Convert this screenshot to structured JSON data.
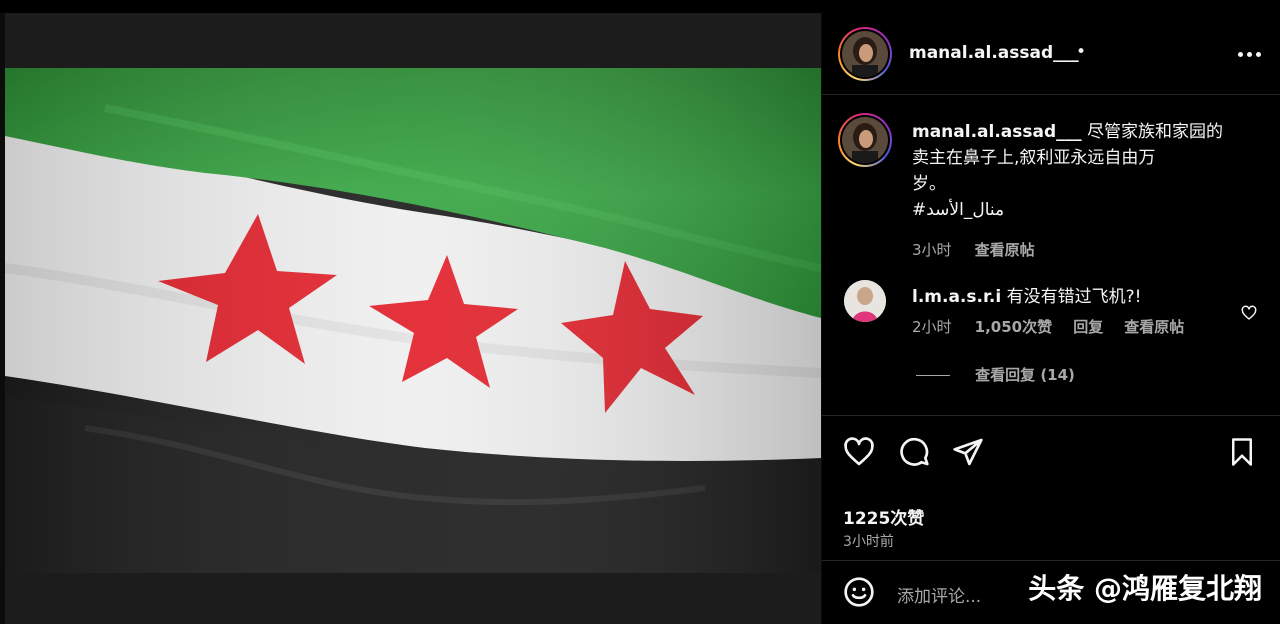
{
  "post": {
    "username": "manal.al.assad___",
    "header_dot": "•",
    "caption_text": "尽管家族和家园的卖主在鼻子上,叙利亚永远自由万岁。",
    "caption_line1": "尽管家族和家园的",
    "caption_line2": "卖主在鼻子上,叙利亚永远自由万",
    "caption_line3": "岁。",
    "hashtag": "#منال_الأسد",
    "caption_time": "3小时",
    "see_translation": "查看原帖"
  },
  "comment": {
    "username": "l.m.a.s.r.i",
    "text": "有没有错过飞机?!",
    "time": "2小时",
    "likes": "1,050次赞",
    "reply": "回复",
    "see_translation": "查看原帖",
    "view_replies": "查看回复 (14)"
  },
  "stats": {
    "likes": "1225次赞",
    "time_ago": "3小时前"
  },
  "add_comment": {
    "placeholder": "添加评论..."
  },
  "watermark": "头条 @鸿雁复北翔",
  "icons": {
    "like": "heart-icon",
    "comment": "comment-bubble-icon",
    "share": "send-paper-plane-icon",
    "save": "bookmark-icon",
    "emoji": "emoji-smiley-icon",
    "more": "more-options-icon",
    "comment_like": "small-heart-icon"
  },
  "colors": {
    "flag_green": "#2e9a3a",
    "flag_white": "#f0f0f0",
    "flag_black": "#1e1e1e",
    "flag_star": "#e3252f",
    "panel_bg": "#000000",
    "muted_text": "#a8a8a8"
  }
}
